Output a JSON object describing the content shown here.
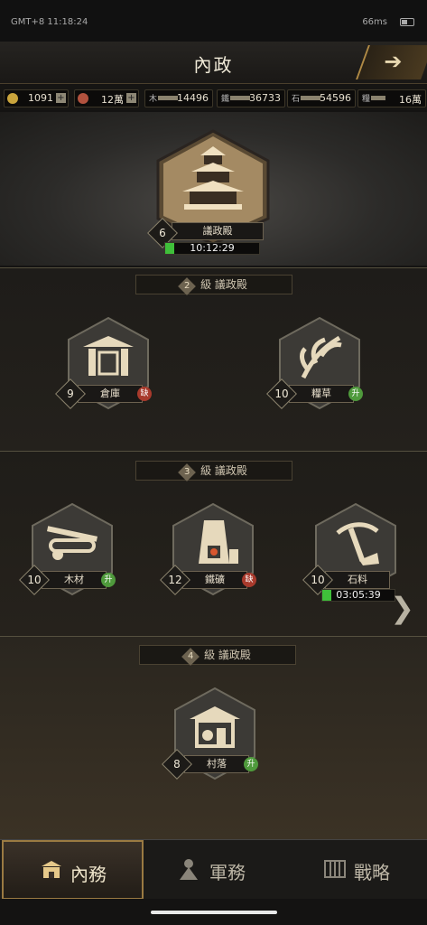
{
  "status": {
    "time": "GMT+8 11:18:24",
    "ping": "66ms"
  },
  "header": {
    "title": "內政"
  },
  "resources": [
    {
      "name": "coin",
      "value": "1091",
      "color": "#c9a43c"
    },
    {
      "name": "token",
      "value": "12萬",
      "color": "#b2523e"
    },
    {
      "label": "木",
      "value": "14496"
    },
    {
      "label": "鐵",
      "value": "36733"
    },
    {
      "label": "石",
      "value": "54596"
    },
    {
      "label": "糧",
      "value": "16萬"
    }
  ],
  "main": {
    "hall": {
      "name": "議政殿",
      "level": "6",
      "timer": "10:12:29",
      "progress": 0.1
    },
    "sections": [
      {
        "num": "2",
        "label": "級 議政殿",
        "buildings": [
          {
            "name": "倉庫",
            "level": "9",
            "badge": "缺"
          },
          {
            "name": "糧草",
            "level": "10",
            "badge": "升"
          }
        ]
      },
      {
        "num": "3",
        "label": "級 議政殿",
        "buildings": [
          {
            "name": "木材",
            "level": "10",
            "badge": "升"
          },
          {
            "name": "鐵礦",
            "level": "12",
            "badge": "缺"
          },
          {
            "name": "石料",
            "level": "10",
            "timer": "03:05:39",
            "progress": 0.12
          }
        ]
      },
      {
        "num": "4",
        "label": "級 議政殿",
        "buildings": [
          {
            "name": "村落",
            "level": "8",
            "badge": "升"
          }
        ]
      }
    ]
  },
  "tabs": [
    {
      "label": "內務",
      "icon": "palace-icon",
      "active": true
    },
    {
      "label": "軍務",
      "icon": "soldier-icon",
      "active": false
    },
    {
      "label": "戰略",
      "icon": "scroll-icon",
      "active": false
    }
  ],
  "colors": {
    "accent": "#b08a45",
    "upgrade": "#4f9a3c",
    "lack": "#a83a2c",
    "progress": "#3fbf3a"
  }
}
